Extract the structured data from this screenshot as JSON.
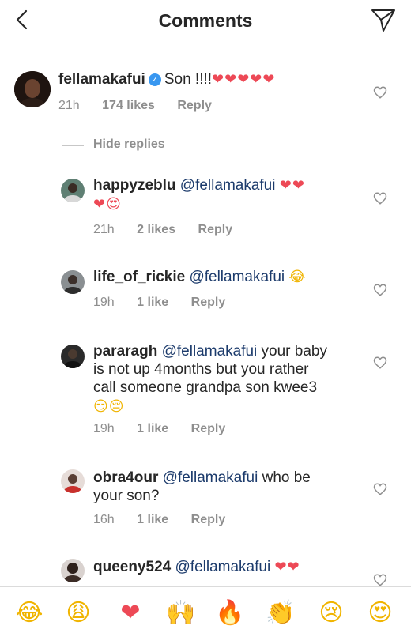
{
  "header": {
    "title": "Comments"
  },
  "main_comment": {
    "username": "fellamakafui",
    "text": "Son !!!!",
    "emojis": "❤❤❤❤❤",
    "time": "21h",
    "likes": "174 likes",
    "reply": "Reply"
  },
  "hide_replies": "Hide replies",
  "replies": [
    {
      "username": "happyzeblu",
      "mention": "@fellamakafui",
      "emojis_line1": "❤❤",
      "emojis_line2": "❤😍",
      "time": "21h",
      "likes": "2 likes",
      "reply": "Reply"
    },
    {
      "username": "life_of_rickie",
      "mention": "@fellamakafui",
      "emojis_line1": "😂",
      "time": "19h",
      "likes": "1 like",
      "reply": "Reply"
    },
    {
      "username": "pararagh",
      "mention": "@fellamakafui",
      "text_line1": "your baby",
      "text_line2": "is not up 4months but you rather",
      "text_line3": "call someone grandpa son kwee3",
      "emojis_line4": "😏😔",
      "time": "19h",
      "likes": "1 like",
      "reply": "Reply"
    },
    {
      "username": "obra4our",
      "mention": "@fellamakafui",
      "text_line1": "who be",
      "text_line2": "your son?",
      "time": "16h",
      "likes": "1 like",
      "reply": "Reply"
    },
    {
      "username": "queeny524",
      "mention": "@fellamakafui",
      "emojis_line1": "❤❤"
    }
  ],
  "emoji_bar": [
    "😂",
    "😩",
    "❤",
    "🙌",
    "🔥",
    "👏",
    "😢",
    "😍"
  ],
  "colors": {
    "mention": "#1b3a6b",
    "meta": "#8e8e8e",
    "heart": "#ed4956",
    "verified": "#3897f0"
  }
}
